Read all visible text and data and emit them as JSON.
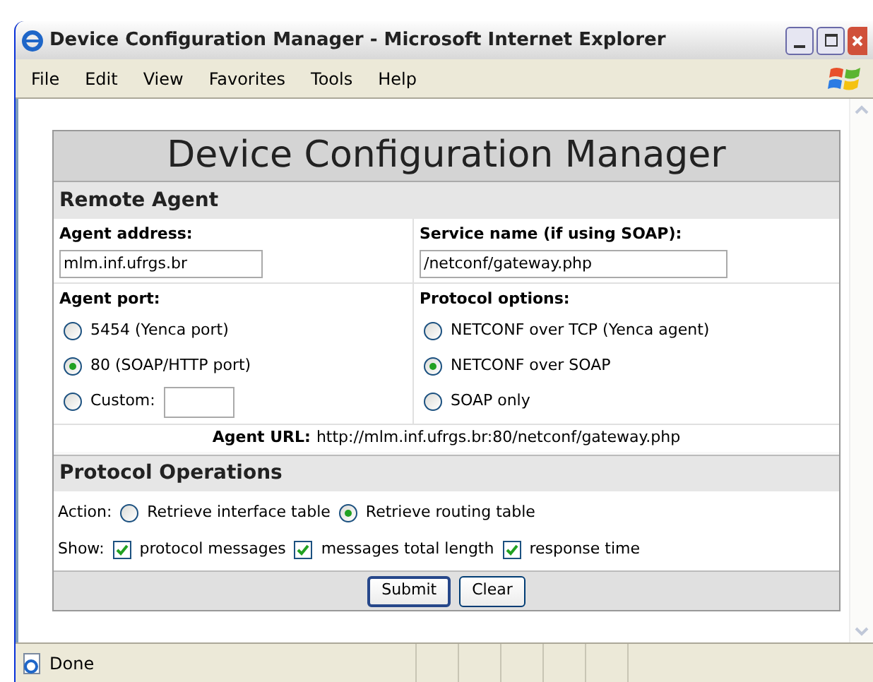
{
  "window": {
    "title": "Device Configuration Manager - Microsoft Internet Explorer"
  },
  "menu": [
    "File",
    "Edit",
    "View",
    "Favorites",
    "Tools",
    "Help"
  ],
  "form": {
    "title": "Device Configuration Manager",
    "remote_agent": {
      "heading": "Remote Agent",
      "agent_address": {
        "label": "Agent address:",
        "value": "mlm.inf.ufrgs.br"
      },
      "service_name": {
        "label": "Service name (if using SOAP):",
        "value": "/netconf/gateway.php"
      },
      "agent_port": {
        "label": "Agent port:",
        "options": [
          {
            "label": "5454 (Yenca port)",
            "selected": false
          },
          {
            "label": "80 (SOAP/HTTP port)",
            "selected": true
          },
          {
            "label": "Custom:",
            "selected": false,
            "kind": "custom"
          }
        ]
      },
      "protocol_options": {
        "label": "Protocol options:",
        "options": [
          {
            "label": "NETCONF over TCP (Yenca agent)",
            "selected": false
          },
          {
            "label": "NETCONF over SOAP",
            "selected": true
          },
          {
            "label": "SOAP only",
            "selected": false
          }
        ]
      },
      "agent_url": {
        "label": "Agent URL:",
        "value": "http://mlm.inf.ufrgs.br:80/netconf/gateway.php"
      }
    },
    "protocol_operations": {
      "heading": "Protocol Operations",
      "action": {
        "label": "Action:",
        "options": [
          {
            "label": "Retrieve interface table",
            "selected": false
          },
          {
            "label": "Retrieve routing table",
            "selected": true
          }
        ]
      },
      "show": {
        "label": "Show:",
        "options": [
          {
            "label": "protocol messages",
            "checked": true
          },
          {
            "label": "messages total length",
            "checked": true
          },
          {
            "label": "response time",
            "checked": true
          }
        ]
      }
    },
    "buttons": [
      "Submit",
      "Clear"
    ]
  },
  "status_bar": {
    "text": "Done"
  }
}
